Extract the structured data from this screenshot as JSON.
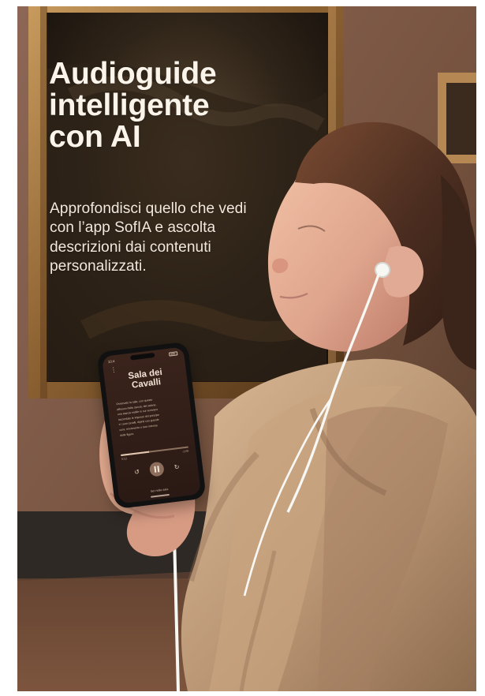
{
  "hero": {
    "title": "Audioguide intelligente con AI",
    "subtitle": "Approfondisci quello che vedi con l’app SofIA e ascolta descrizioni dai contenuti personalizzati."
  },
  "phone": {
    "status_time": "10:4",
    "room_title": "Sala dei Cavalli",
    "description": [
      "Osservate la sala, con questo",
      "affresco della caccia, del salone,",
      "una stanza nobile in cui venivano",
      "raccontate le imprese del principe",
      "e i suoi cavalli, dipinti con grande",
      "cura, movimento e luce intensa",
      "delle figure."
    ],
    "time_elapsed": "0:12",
    "time_remaining": "-1:00",
    "listen_hint": "Sei nella sala",
    "progress_percent": 42
  },
  "colors": {
    "text": "#fbf4eb",
    "phone_screen": "#2a1914",
    "accent": "#8d6e5d"
  },
  "icons": {
    "menu": "menu-icon",
    "rewind": "rewind-icon",
    "pause": "pause-icon",
    "forward": "forward-icon",
    "battery": "battery-icon"
  }
}
